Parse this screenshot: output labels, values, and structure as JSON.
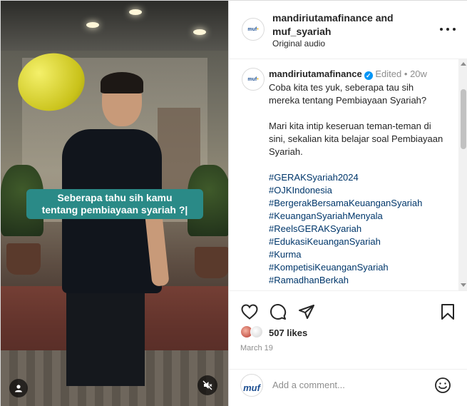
{
  "video": {
    "overlay_caption_line1": "Seberapa tahu sih kamu",
    "overlay_caption_line2": "tentang pembiayaan syariah ?|",
    "user_icon": "user-icon",
    "mute_icon": "speaker-muted-icon"
  },
  "header": {
    "account_line1": "mandiriutamafinance and",
    "account_line2": "muf_syariah",
    "audio": "Original audio",
    "more_icon": "more-options-icon"
  },
  "post": {
    "username": "mandiriutamafinance",
    "edited": "Edited",
    "separator": "•",
    "age": "20w",
    "paragraph1": "Coba kita tes yuk, seberapa tau sih mereka tentang Pembiayaan Syariah?",
    "paragraph2": "Mari kita intip keseruan teman-teman di sini, sekalian kita belajar soal Pembiayaan Syariah.",
    "hashtags": [
      "#GERAKSyariah2024",
      "#OJKIndonesia",
      "#BergerakBersamaKeuanganSyariah",
      "#KeuanganSyariahMenyala",
      "#ReelsGERAKSyariah",
      "#EdukasiKeuanganSyariah",
      "#Kurma",
      "#KompetisiKeuanganSyariah",
      "#RamadhanBerkah"
    ]
  },
  "actions": {
    "likes": "507 likes",
    "date": "March 19"
  },
  "comment": {
    "placeholder": "Add a comment...",
    "avatar_text": "muf"
  },
  "colors": {
    "caption_bg": "#2a8a87",
    "verified": "#0095f6",
    "hashtag": "#00376b",
    "muted_text": "#8e8e8e"
  }
}
